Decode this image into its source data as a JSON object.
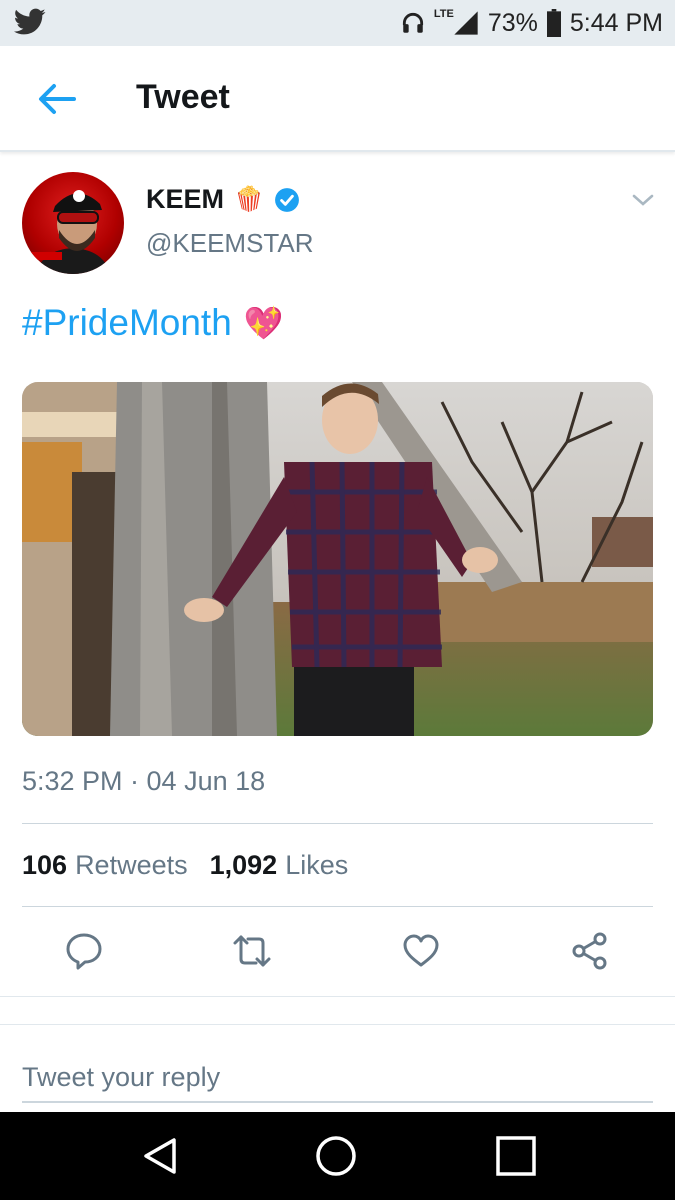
{
  "status_bar": {
    "app_icon": "twitter-bird-icon",
    "network": "LTE",
    "battery": "73%",
    "time": "5:44 PM",
    "icons": [
      "headphones-icon",
      "signal-icon",
      "battery-icon"
    ]
  },
  "header": {
    "title": "Tweet",
    "back_icon": "back-arrow-icon"
  },
  "tweet": {
    "name": "KEEM",
    "name_emoji": "🍿",
    "handle": "@KEEMSTAR",
    "verified": true,
    "text": "#PrideMonth",
    "text_emoji": "💖",
    "timestamp": "5:32 PM · 04 Jun 18",
    "stats": {
      "retweets_count": "106",
      "retweets_label": "Retweets",
      "likes_count": "1,092",
      "likes_label": "Likes"
    }
  },
  "actions": [
    "reply-icon",
    "retweet-icon",
    "like-icon",
    "share-icon"
  ],
  "reply": {
    "placeholder": "Tweet your reply"
  },
  "nav": [
    "back-triangle-icon",
    "home-circle-icon",
    "recents-square-icon"
  ],
  "colors": {
    "accent": "#1da1f2",
    "secondary_text": "#657786",
    "status_bar_bg": "#e6ecf0",
    "nav_bg": "#000000"
  }
}
